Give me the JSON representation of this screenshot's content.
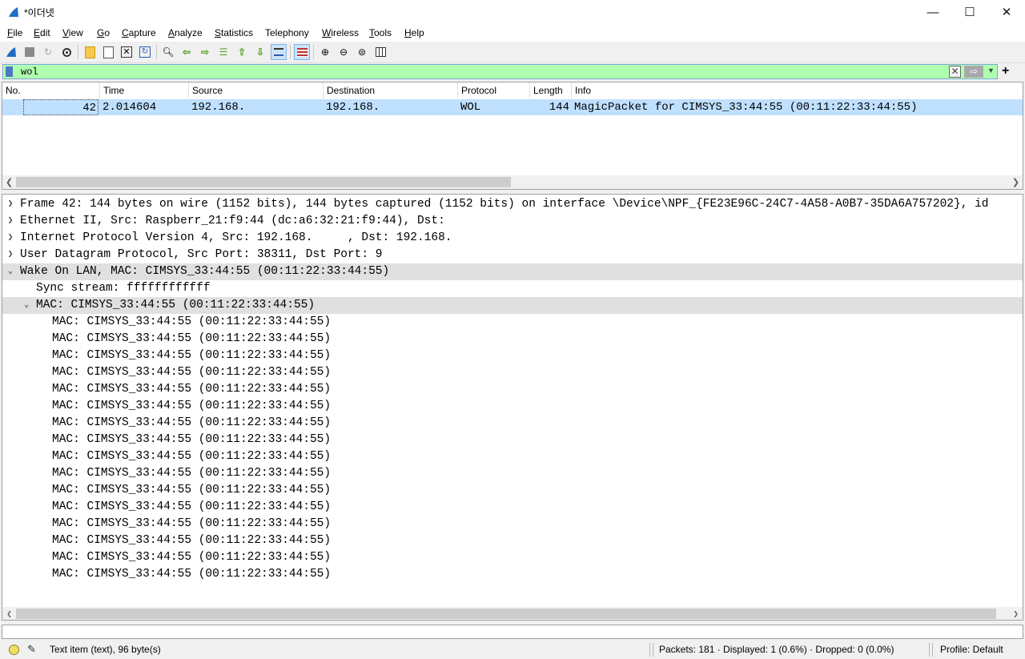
{
  "window": {
    "title": "*이더넷",
    "minimize": "—",
    "maximize": "☐",
    "close": "✕"
  },
  "menu": [
    {
      "label": "File",
      "u": "F",
      "rest": "ile"
    },
    {
      "label": "Edit",
      "u": "E",
      "rest": "dit"
    },
    {
      "label": "View",
      "u": "V",
      "rest": "iew"
    },
    {
      "label": "Go",
      "u": "G",
      "rest": "o"
    },
    {
      "label": "Capture",
      "u": "C",
      "rest": "apture"
    },
    {
      "label": "Analyze",
      "u": "A",
      "rest": "nalyze"
    },
    {
      "label": "Statistics",
      "u": "S",
      "rest": "tatistics"
    },
    {
      "label": "Telephony",
      "u": "",
      "rest": "Telephony"
    },
    {
      "label": "Wireless",
      "u": "W",
      "rest": "ireless"
    },
    {
      "label": "Tools",
      "u": "T",
      "rest": "ools"
    },
    {
      "label": "Help",
      "u": "H",
      "rest": "elp"
    }
  ],
  "filter": {
    "value": "wol"
  },
  "packet_list": {
    "columns": [
      "No.",
      "Time",
      "Source",
      "Destination",
      "Protocol",
      "Length",
      "Info"
    ],
    "rows": [
      {
        "no": "42",
        "time": "2.014604",
        "source": "192.168.",
        "destination": "192.168.",
        "protocol": "WOL",
        "length": "144",
        "info": "MagicPacket for CIMSYS_33:44:55 (00:11:22:33:44:55)"
      }
    ]
  },
  "details": {
    "frame": "Frame 42: 144 bytes on wire (1152 bits), 144 bytes captured (1152 bits) on interface \\Device\\NPF_{FE23E96C-24C7-4A58-A0B7-35DA6A757202}, id",
    "ethernet": "Ethernet II, Src: Raspberr_21:f9:44 (dc:a6:32:21:f9:44), Dst:",
    "ip": "Internet Protocol Version 4, Src: 192.168.     , Dst: 192.168.",
    "udp": "User Datagram Protocol, Src Port: 38311, Dst Port: 9",
    "wol": "Wake On LAN, MAC: CIMSYS_33:44:55 (00:11:22:33:44:55)",
    "sync": "Sync stream: ffffffffffff",
    "mac_parent": "MAC: CIMSYS_33:44:55 (00:11:22:33:44:55)",
    "mac_children": [
      "MAC: CIMSYS_33:44:55 (00:11:22:33:44:55)",
      "MAC: CIMSYS_33:44:55 (00:11:22:33:44:55)",
      "MAC: CIMSYS_33:44:55 (00:11:22:33:44:55)",
      "MAC: CIMSYS_33:44:55 (00:11:22:33:44:55)",
      "MAC: CIMSYS_33:44:55 (00:11:22:33:44:55)",
      "MAC: CIMSYS_33:44:55 (00:11:22:33:44:55)",
      "MAC: CIMSYS_33:44:55 (00:11:22:33:44:55)",
      "MAC: CIMSYS_33:44:55 (00:11:22:33:44:55)",
      "MAC: CIMSYS_33:44:55 (00:11:22:33:44:55)",
      "MAC: CIMSYS_33:44:55 (00:11:22:33:44:55)",
      "MAC: CIMSYS_33:44:55 (00:11:22:33:44:55)",
      "MAC: CIMSYS_33:44:55 (00:11:22:33:44:55)",
      "MAC: CIMSYS_33:44:55 (00:11:22:33:44:55)",
      "MAC: CIMSYS_33:44:55 (00:11:22:33:44:55)",
      "MAC: CIMSYS_33:44:55 (00:11:22:33:44:55)",
      "MAC: CIMSYS_33:44:55 (00:11:22:33:44:55)"
    ]
  },
  "status": {
    "item": "Text item (text), 96 byte(s)",
    "packets": "Packets: 181 · Displayed: 1 (0.6%) · Dropped: 0 (0.0%)",
    "profile": "Profile: Default"
  },
  "colors": {
    "filter_ok": "#afffaf",
    "selected_row": "#bfe0ff",
    "highlight": "#e0e0e0",
    "accent": "#4a78c2"
  }
}
